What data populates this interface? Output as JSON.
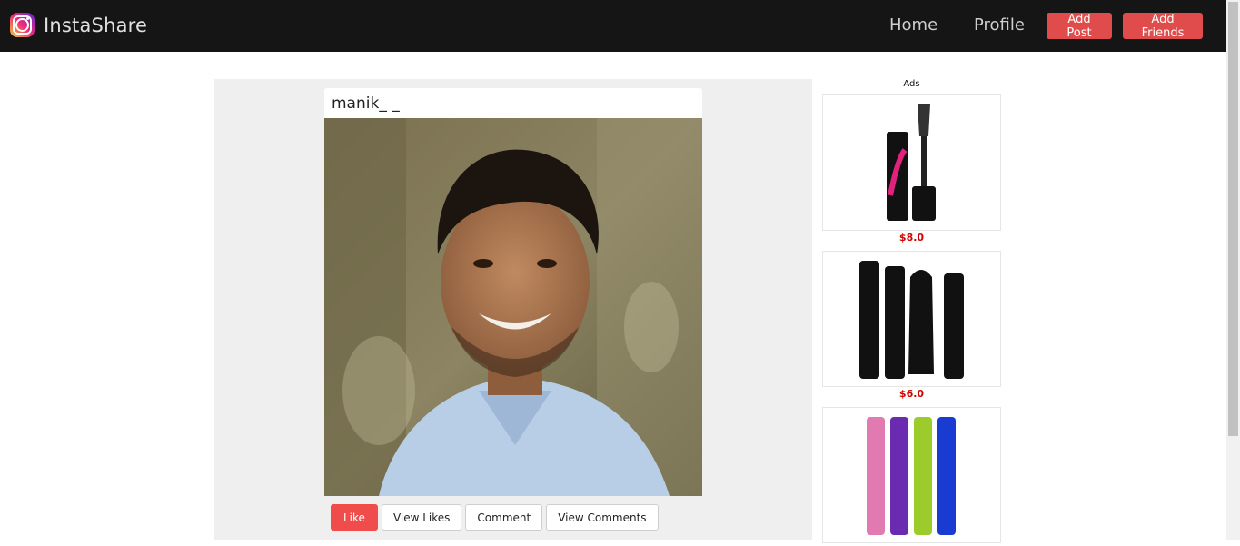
{
  "app": {
    "name": "InstaShare"
  },
  "nav": {
    "home": "Home",
    "profile": "Profile",
    "add_post": "Add Post",
    "add_friends": "Add Friends"
  },
  "post": {
    "username": "manik_ _",
    "actions": {
      "like": "Like",
      "view_likes": "View Likes",
      "comment": "Comment",
      "view_comments": "View Comments"
    }
  },
  "ads": {
    "title": "Ads",
    "items": [
      {
        "price": "$8.0"
      },
      {
        "price": "$6.0"
      },
      {
        "price": ""
      }
    ]
  },
  "colors": {
    "navbar": "#151515",
    "accent": "#e04b4b",
    "price": "#d10000",
    "feed_bg": "#efefef"
  }
}
